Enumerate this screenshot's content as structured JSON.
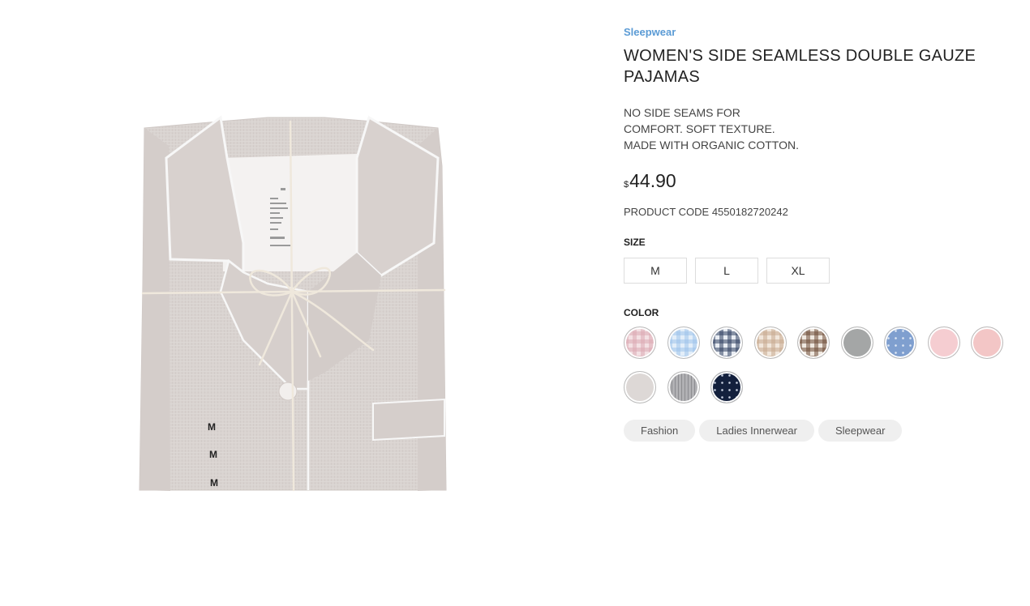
{
  "product": {
    "category": "Sleepwear",
    "title": "WOMEN'S SIDE SEAMLESS DOUBLE GAUZE PAJAMAS",
    "description_lines": [
      "NO SIDE SEAMS FOR",
      "COMFORT. SOFT TEXTURE.",
      "MADE WITH ORGANIC COTTON."
    ],
    "currency": "$",
    "price": "44.90",
    "product_code": "PRODUCT CODE 4550182720242"
  },
  "size": {
    "label": "SIZE",
    "options": [
      "M",
      "L",
      "XL"
    ]
  },
  "color": {
    "label": "COLOR",
    "swatches": [
      {
        "name": "pink-check-swatch",
        "pattern": "check",
        "base": "#f3e0e3",
        "line": "#dca8b2"
      },
      {
        "name": "light-blue-check-swatch",
        "pattern": "check",
        "base": "#e3eef9",
        "line": "#9dc3ea"
      },
      {
        "name": "navy-check-swatch",
        "pattern": "check",
        "base": "#e8ecf2",
        "line": "#2f3f5f"
      },
      {
        "name": "beige-check-swatch",
        "pattern": "check",
        "base": "#f1e6db",
        "line": "#c7a98e"
      },
      {
        "name": "brown-check-swatch",
        "pattern": "check",
        "base": "#efe8e0",
        "line": "#6b4a35"
      },
      {
        "name": "gray-swatch",
        "pattern": "solid",
        "base": "#a4a6a6"
      },
      {
        "name": "blue-dot-swatch",
        "pattern": "dots",
        "base": "#7f9fcf",
        "line": "#dfe7f3"
      },
      {
        "name": "pink-swatch",
        "pattern": "solid",
        "base": "#f5cdd1"
      },
      {
        "name": "light-pink-swatch",
        "pattern": "solid",
        "base": "#f3c6c6"
      },
      {
        "name": "light-gray-swatch",
        "pattern": "solid",
        "base": "#ddd8d6"
      },
      {
        "name": "gray-stripe-swatch",
        "pattern": "stripe",
        "base": "#b1b1b4",
        "line": "#8c8c90"
      },
      {
        "name": "navy-dot-swatch",
        "pattern": "dots",
        "base": "#13203d",
        "line": "#c8d0e0"
      }
    ]
  },
  "tags": [
    "Fashion",
    "Ladies Innerwear",
    "Sleepwear"
  ],
  "image": {
    "size_tag_letter": "M"
  }
}
